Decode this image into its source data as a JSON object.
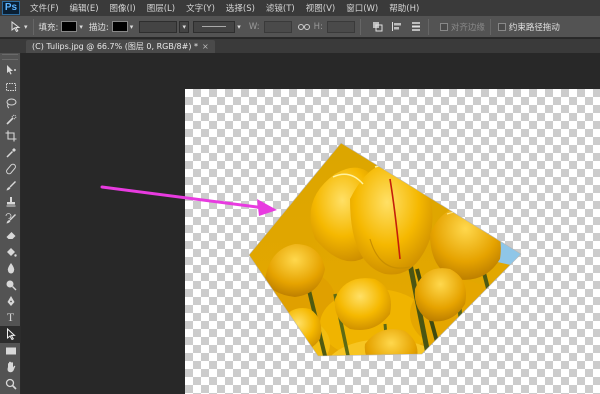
{
  "app": {
    "logo": "Ps"
  },
  "menu": [
    "文件(F)",
    "编辑(E)",
    "图像(I)",
    "图层(L)",
    "文字(Y)",
    "选择(S)",
    "滤镜(T)",
    "视图(V)",
    "窗口(W)",
    "帮助(H)"
  ],
  "options": {
    "fill_label": "填充:",
    "stroke_label": "描边:",
    "w_label": "W:",
    "h_label": "H:",
    "align_edges_label": "对齐边缘",
    "constrain_path_label": "约束路径拖动",
    "fill_color": "#000000",
    "stroke_color": "#000000",
    "align_edges_checked": false,
    "constrain_path_checked": false
  },
  "document": {
    "tab_title": "(C) Tulips.jpg @ 66.7% (图层 0, RGB/8#) *",
    "close_glyph": "×"
  },
  "tools": [
    "move",
    "marquee",
    "lasso",
    "quick-select",
    "crop",
    "eyedropper",
    "healing-brush",
    "brush",
    "clone-stamp",
    "history-brush",
    "eraser",
    "paint-bucket",
    "blur",
    "dodge",
    "pen",
    "type",
    "path-selection",
    "rectangle",
    "hand",
    "zoom"
  ],
  "active_tool": "path-selection",
  "colors": {
    "arrow": "#e83be0",
    "canvas_bg": "#282828",
    "menubar": "#3a3a3a",
    "optionsbar": "#535353"
  }
}
